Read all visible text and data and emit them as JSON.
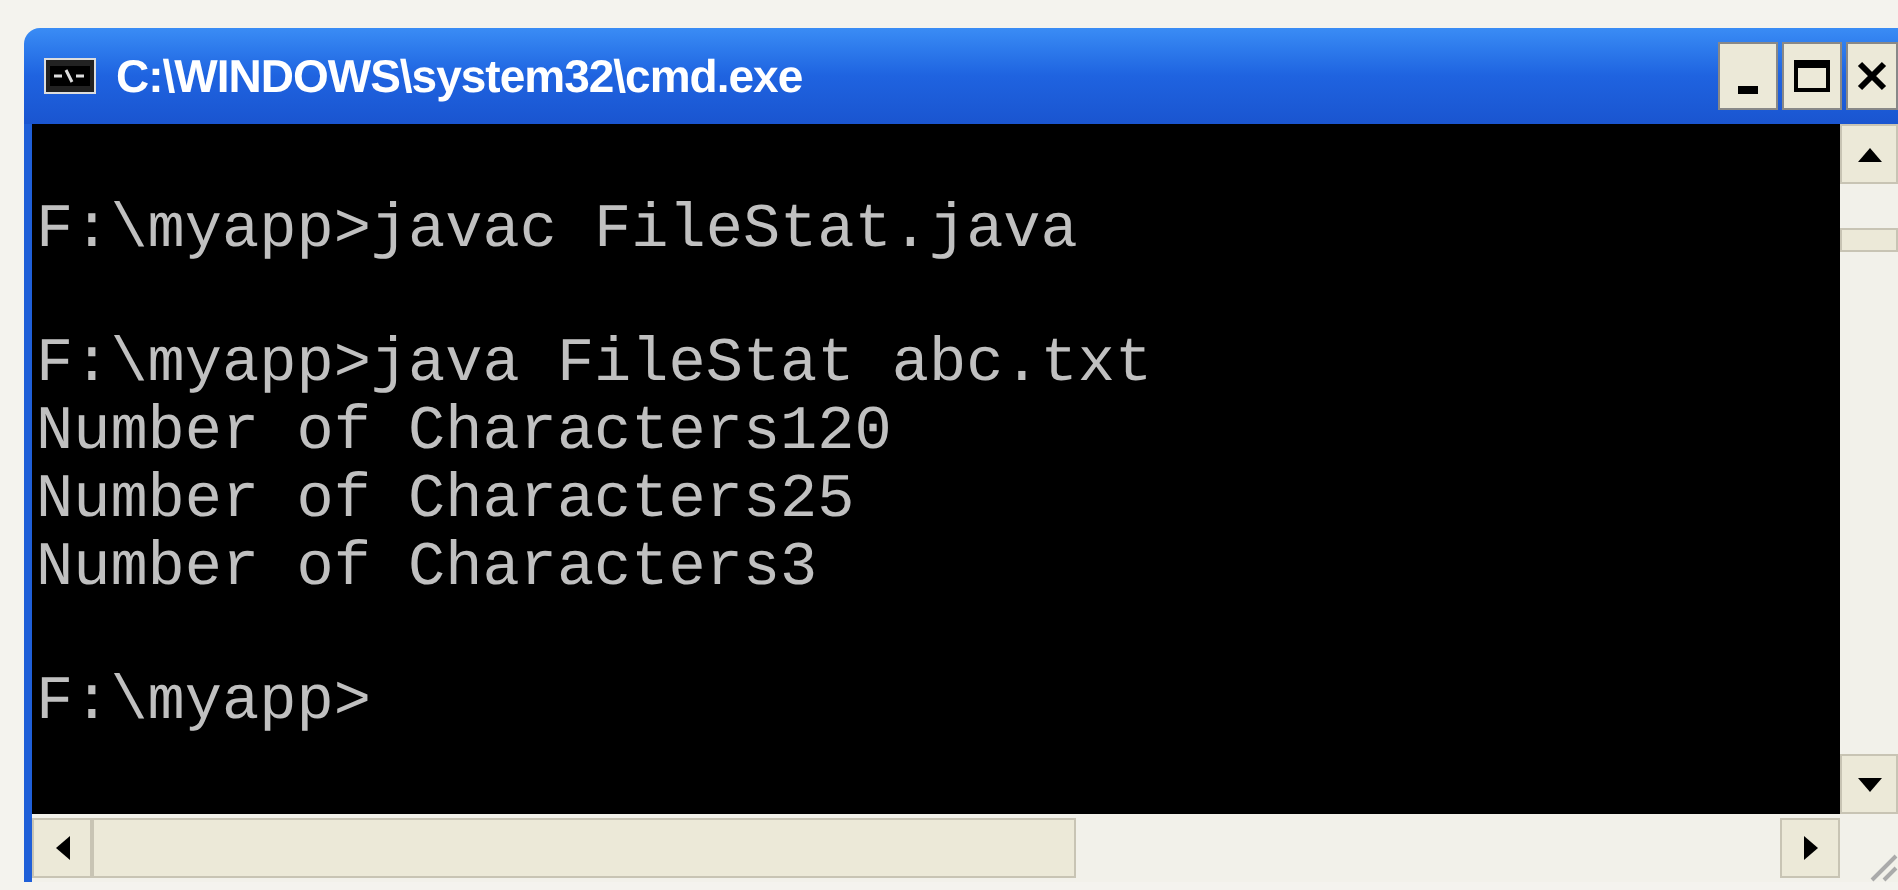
{
  "window": {
    "title": "C:\\WINDOWS\\system32\\cmd.exe"
  },
  "console": {
    "groups": [
      [
        "F:\\myapp>javac FileStat.java"
      ],
      [
        "F:\\myapp>java FileStat abc.txt",
        "Number of Characters120",
        "Number of Characters25",
        "Number of Characters3"
      ],
      [
        "F:\\myapp>"
      ]
    ]
  }
}
